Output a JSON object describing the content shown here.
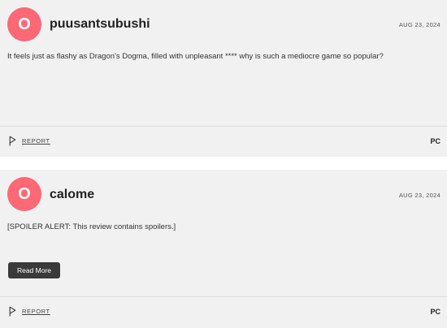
{
  "reviews": [
    {
      "avatar_letter": "O",
      "username": "puusantsubushi",
      "date": "AUG 23, 2024",
      "text": "It feels just as flashy as Dragon's Dogma, filled with unpleasant **** why is such a mediocre game so popular?",
      "report_label": "REPORT",
      "platform": "PC"
    },
    {
      "avatar_letter": "O",
      "username": "calome",
      "date": "AUG 23, 2024",
      "text": "[SPOILER ALERT: This review contains spoilers.]",
      "read_more_label": "Read More",
      "report_label": "REPORT",
      "platform": "PC"
    }
  ],
  "colors": {
    "avatar_bg": "#ff6874",
    "card_bg": "#f1f1f1",
    "button_bg": "#3a3a3a"
  },
  "icons": {
    "report": "flag-icon"
  }
}
